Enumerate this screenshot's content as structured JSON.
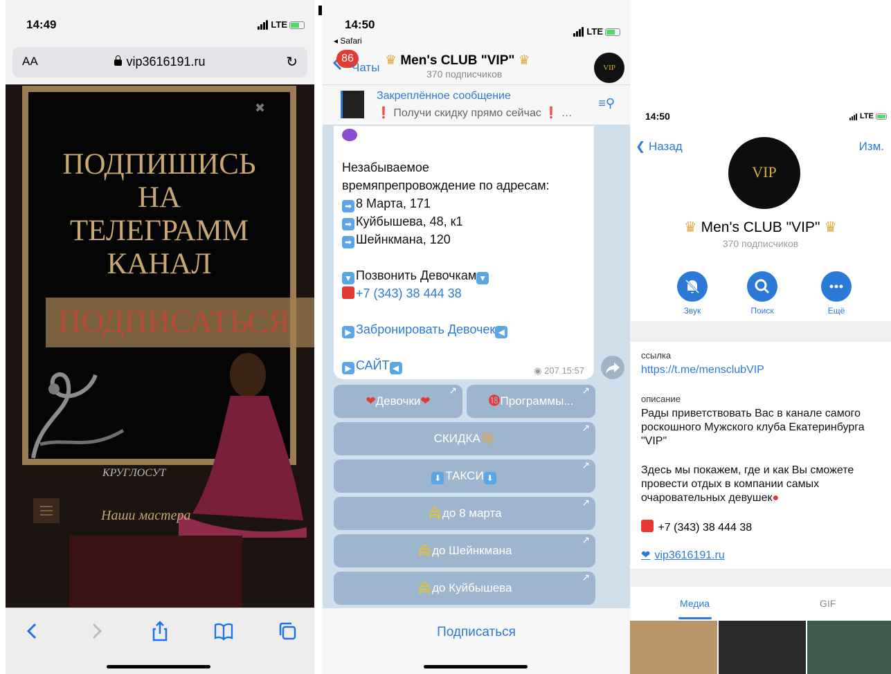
{
  "safari": {
    "time": "14:49",
    "network": "LTE",
    "aa": "AA",
    "url": "vip3616191.ru",
    "headline": [
      "ПОДПИШИСЬ",
      "НА",
      "ТЕЛЕГРАММ",
      "КАНАЛ"
    ],
    "subscribe_button": "ПОДПИСАТЬСЯ",
    "around_clock": "КРУГЛОСУТ",
    "our_masters": "Наши мастера"
  },
  "chat": {
    "time": "14:50",
    "back_app": "◂ Safari",
    "network": "LTE",
    "unread": "86",
    "back_label": "Чаты",
    "channel_title": "Men's CLUB \"VIP\"",
    "subscribers": "370 подписчиков",
    "avatar_text": "VIP",
    "pinned_title": "Закреплённое сообщение",
    "pinned_text": "Получи скидку прямо сейчас",
    "message": {
      "line1": "Незабываемое",
      "line2": "времяпрепровождение по адресам:",
      "addr1": "8 Марта, 171",
      "addr2": "Куйбышева, 48, к1",
      "addr3": "Шейнкмана, 120",
      "call": "Позвонить Девочкам",
      "phone": "+7 (343) 38 444 38",
      "book": "Забронировать Девочек",
      "site": "САЙТ",
      "views": "207",
      "time": "15:57"
    },
    "buttons": [
      "Девочки",
      "Программы...",
      "СКИДКА",
      "ТАКСИ",
      "до 8 марта",
      "до Шейнкмана",
      "до Куйбышева"
    ],
    "subscribe": "Подписаться"
  },
  "profile": {
    "time": "14:50",
    "network": "LTE",
    "back": "Назад",
    "edit": "Изм.",
    "avatar_text": "VIP",
    "name": "Men's CLUB \"VIP\"",
    "subscribers": "370 подписчиков",
    "actions": [
      "Звук",
      "Поиск",
      "Ещё"
    ],
    "link_label": "ссылка",
    "link": "https://t.me/mensclubVIP",
    "desc_label": "описание",
    "desc1": "Рады приветствовать Вас в канале самого роскошного Мужского клуба Екатеринбурга \"VIP\"",
    "desc2": "Здесь мы покажем, где и как Вы сможете провести отдых в компании самых очаровательных девушек",
    "phone": "+7 (343) 38 444 38",
    "site": "vip3616191.ru",
    "tabs": [
      "Медиа",
      "GIF"
    ]
  }
}
